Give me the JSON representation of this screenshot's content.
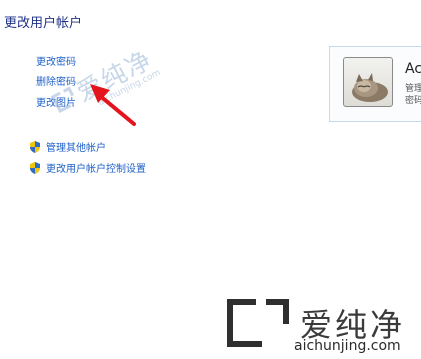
{
  "page": {
    "title": "更改用户帐户"
  },
  "tasks": {
    "change_password": "更改密码",
    "remove_password": "删除密码",
    "change_picture": "更改图片",
    "manage_other_accounts": "管理其他帐户",
    "uac_settings": "更改用户帐户控制设置"
  },
  "account": {
    "name": "Ac",
    "line1": "管理",
    "line2": "密码"
  },
  "watermark": {
    "small_cn": "爱纯净",
    "small_en": "aichunjing.com",
    "big_cn": "爱纯净",
    "big_en": "aichunjing.com"
  },
  "colors": {
    "link": "#1e60c8",
    "title": "#1e3287",
    "arrow": "#e3141c",
    "card_border": "#c9d7ea"
  },
  "icons": {
    "shield": "uac-shield",
    "avatar": "kitten-photo",
    "pointer": "red-arrow"
  }
}
